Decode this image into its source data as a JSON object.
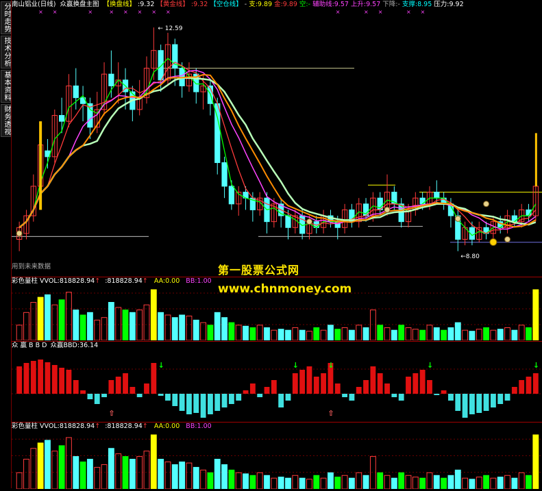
{
  "sidebar": {
    "tabs": [
      {
        "label": "分时走势"
      },
      {
        "label": "技术分析"
      },
      {
        "label": "基本资料"
      },
      {
        "label": "财务透视"
      }
    ]
  },
  "header": {
    "stock": "南山铝业(日线)",
    "indicator": "众赢换盘主图",
    "items": [
      {
        "text": "【换盘线】",
        "color": "#ffff00"
      },
      {
        "text": ":9.32",
        "color": "#ffffff"
      },
      {
        "text": "【黄金线】",
        "color": "#ff3b3b"
      },
      {
        "text": ":9.32",
        "color": "#ff3b3b"
      },
      {
        "text": "【空仓线】",
        "color": "#00ffff"
      },
      {
        "text": "-",
        "color": "#cccccc"
      },
      {
        "text": "支:9.89",
        "color": "#ffff00"
      },
      {
        "text": "金:9.89",
        "color": "#ff3b3b"
      },
      {
        "text": "空:-",
        "color": "#00ff00"
      },
      {
        "text": "辅助线:9.57",
        "color": "#ff44ff"
      },
      {
        "text": "上升:9.57",
        "color": "#ff44ff"
      },
      {
        "text": "下降:-",
        "color": "#aaaaaa"
      },
      {
        "text": "支撑:8.95",
        "color": "#00ffff"
      },
      {
        "text": "压力:9.92",
        "color": "#ffffff"
      }
    ]
  },
  "main_chart": {
    "high_label": "12.59",
    "low_label": "8.80",
    "future_label": "用到未来数据"
  },
  "watermark": {
    "line1": "第一股票公式网",
    "line2": "www.chnmoney.com"
  },
  "vol_panel": {
    "name": "彩色量柱",
    "vvol": "VVOL:818828.94",
    "val2": ":818828.94",
    "aa": "AA:0.00",
    "bb": "BB:1.00"
  },
  "bbd_panel": {
    "title": "众 赢 B B D",
    "value": "众赢BBD:36.14"
  },
  "vol_panel2": {
    "name": "彩色量柱",
    "vvol": "VVOL:818828.94",
    "val2": ":818828.94",
    "aa": "AA:0.00",
    "bb": "BB:1.00"
  },
  "colors": {
    "up": "#ff3b3b",
    "down": "#54ffff",
    "yellow": "#ffff00",
    "green": "#00ff00",
    "magenta": "#ff44ff",
    "orange": "#ff8c00",
    "panel_border": "#a00000"
  },
  "chart_data": {
    "type": "candlestick",
    "ylim": [
      8.6,
      12.8
    ],
    "candles": [
      [
        9.0,
        9.2,
        8.8,
        9.3
      ],
      [
        9.1,
        9.4,
        9.0,
        9.5
      ],
      [
        9.4,
        9.9,
        9.3,
        10.1
      ],
      [
        9.9,
        10.6,
        9.8,
        10.8
      ],
      [
        10.5,
        10.4,
        10.2,
        10.7
      ],
      [
        10.4,
        11.1,
        10.3,
        11.2
      ],
      [
        11.1,
        11.0,
        10.8,
        11.4
      ],
      [
        11.0,
        11.6,
        10.9,
        11.8
      ],
      [
        11.6,
        11.4,
        11.2,
        11.9
      ],
      [
        11.4,
        11.3,
        11.0,
        11.6
      ],
      [
        11.3,
        10.9,
        10.7,
        11.4
      ],
      [
        10.9,
        11.2,
        10.8,
        11.5
      ],
      [
        11.2,
        11.8,
        11.1,
        12.0
      ],
      [
        11.8,
        11.6,
        11.4,
        12.2
      ],
      [
        11.6,
        11.7,
        11.3,
        12.0
      ],
      [
        11.7,
        11.5,
        11.2,
        11.9
      ],
      [
        11.5,
        11.2,
        11.0,
        11.6
      ],
      [
        11.2,
        11.4,
        11.1,
        11.7
      ],
      [
        11.4,
        11.9,
        11.3,
        12.1
      ],
      [
        11.9,
        12.2,
        11.7,
        12.59
      ],
      [
        12.2,
        11.7,
        11.5,
        12.3
      ],
      [
        11.7,
        12.3,
        11.6,
        12.5
      ],
      [
        12.3,
        11.9,
        11.6,
        12.4
      ],
      [
        11.9,
        11.6,
        11.4,
        12.0
      ],
      [
        11.6,
        11.8,
        11.5,
        12.0
      ],
      [
        11.8,
        11.5,
        11.3,
        11.9
      ],
      [
        11.5,
        11.6,
        11.2,
        11.8
      ],
      [
        11.6,
        11.3,
        11.1,
        11.7
      ],
      [
        11.3,
        10.3,
        10.1,
        11.4
      ],
      [
        10.3,
        9.9,
        9.7,
        10.4
      ],
      [
        9.9,
        9.6,
        9.5,
        10.0
      ],
      [
        9.6,
        9.8,
        9.4,
        9.9
      ],
      [
        9.8,
        9.7,
        9.5,
        9.9
      ],
      [
        9.7,
        9.5,
        9.3,
        9.8
      ],
      [
        9.5,
        9.7,
        9.4,
        9.8
      ],
      [
        9.7,
        9.3,
        9.1,
        9.8
      ],
      [
        9.3,
        9.6,
        9.2,
        9.7
      ],
      [
        9.6,
        9.4,
        9.2,
        9.7
      ],
      [
        9.4,
        9.2,
        9.0,
        9.5
      ],
      [
        9.2,
        9.4,
        9.1,
        9.5
      ],
      [
        9.4,
        9.1,
        9.0,
        9.5
      ],
      [
        9.1,
        9.3,
        9.0,
        9.4
      ],
      [
        9.3,
        9.2,
        9.1,
        9.4
      ],
      [
        9.2,
        9.4,
        9.1,
        9.5
      ],
      [
        9.4,
        9.3,
        9.2,
        9.5
      ],
      [
        9.3,
        9.2,
        9.0,
        9.4
      ],
      [
        9.2,
        9.5,
        9.1,
        9.6
      ],
      [
        9.5,
        9.3,
        9.2,
        9.6
      ],
      [
        9.3,
        9.6,
        9.2,
        9.7
      ],
      [
        9.6,
        9.4,
        9.3,
        9.7
      ],
      [
        9.4,
        9.7,
        9.3,
        9.8
      ],
      [
        9.7,
        9.5,
        9.4,
        9.8
      ],
      [
        9.5,
        9.8,
        9.4,
        10.1
      ],
      [
        9.8,
        9.6,
        9.5,
        9.9
      ],
      [
        9.6,
        9.3,
        9.2,
        9.7
      ],
      [
        9.3,
        9.5,
        9.2,
        9.6
      ],
      [
        9.5,
        9.7,
        9.4,
        9.8
      ],
      [
        9.7,
        9.6,
        9.5,
        9.8
      ],
      [
        9.6,
        9.8,
        9.5,
        9.9
      ],
      [
        9.8,
        9.7,
        9.6,
        10.0
      ],
      [
        9.7,
        9.6,
        9.5,
        9.8
      ],
      [
        9.6,
        9.4,
        9.2,
        9.7
      ],
      [
        9.4,
        9.0,
        8.8,
        9.5
      ],
      [
        9.0,
        9.2,
        8.9,
        9.3
      ],
      [
        9.2,
        9.0,
        8.9,
        9.3
      ],
      [
        9.0,
        9.2,
        8.95,
        9.3
      ],
      [
        9.2,
        9.1,
        9.0,
        9.3
      ],
      [
        9.1,
        9.3,
        9.0,
        9.4
      ],
      [
        9.3,
        9.2,
        9.1,
        9.4
      ],
      [
        9.2,
        9.4,
        9.1,
        9.5
      ],
      [
        9.4,
        9.3,
        9.2,
        9.5
      ],
      [
        9.3,
        9.5,
        9.2,
        9.6
      ],
      [
        9.5,
        9.4,
        9.3,
        9.6
      ],
      [
        9.4,
        9.9,
        9.3,
        10.6
      ]
    ]
  }
}
